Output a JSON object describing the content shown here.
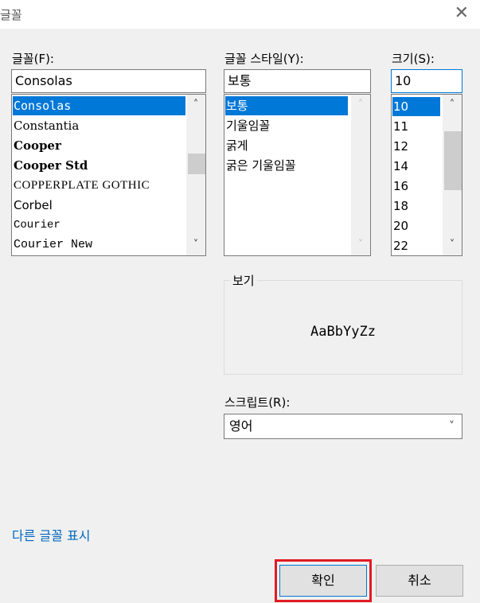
{
  "dialog": {
    "title": "글꼴",
    "close_glyph": "✕"
  },
  "font": {
    "label": "글꼴(F):",
    "value": "Consolas",
    "items": [
      "Consolas",
      "Constantia",
      "Cooper",
      "Cooper Std",
      "COPPERPLATE GOTHIC",
      "Corbel",
      "Courier",
      "Courier New"
    ],
    "selected": "Consolas"
  },
  "style": {
    "label": "글꼴 스타일(Y):",
    "value": "보통",
    "items": [
      "보통",
      "기울임꼴",
      "굵게",
      "굵은 기울임꼴"
    ],
    "selected": "보통"
  },
  "size": {
    "label": "크기(S):",
    "value": "10",
    "items": [
      "10",
      "11",
      "12",
      "14",
      "16",
      "18",
      "20",
      "22"
    ],
    "selected": "10"
  },
  "sample": {
    "label": "보기",
    "text": "AaBbYyZz"
  },
  "script": {
    "label": "스크립트(R):",
    "value": "영어"
  },
  "link": {
    "show_more_fonts": "다른 글꼴 표시"
  },
  "buttons": {
    "ok": "확인",
    "cancel": "취소"
  },
  "colors": {
    "accent": "#0078d7",
    "link": "#0067c0",
    "highlight": "#e11b22"
  },
  "icons": {
    "scroll_up": "chevron-up-icon",
    "scroll_down": "chevron-down-icon",
    "dropdown": "chevron-down-icon",
    "close": "close-icon"
  }
}
